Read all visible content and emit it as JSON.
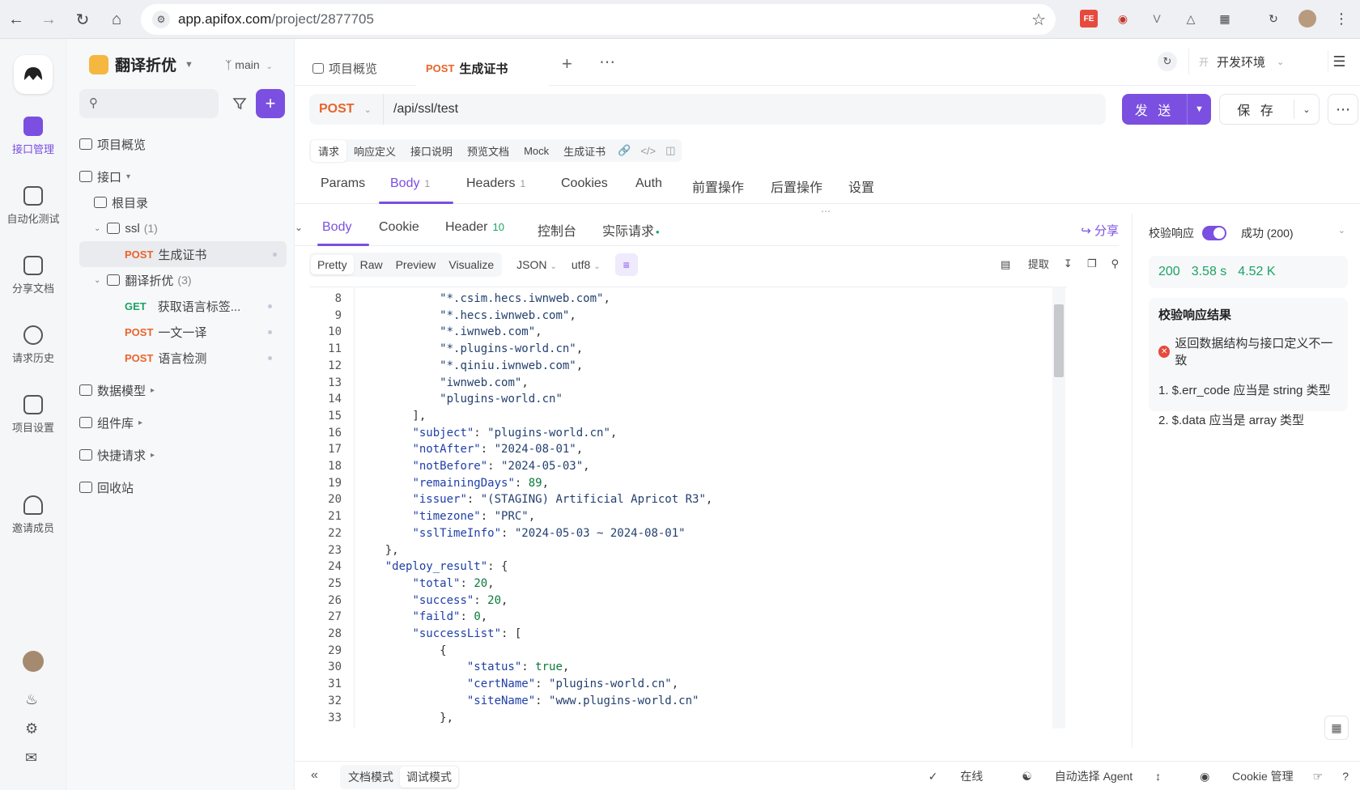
{
  "browser": {
    "url_host": "app.apifox.com",
    "url_path": "/project/2877705"
  },
  "rail": {
    "items": [
      {
        "label": "接口管理",
        "icon": "api-icon"
      },
      {
        "label": "自动化测试",
        "icon": "automation-icon"
      },
      {
        "label": "分享文档",
        "icon": "share-doc-icon"
      },
      {
        "label": "请求历史",
        "icon": "history-icon"
      },
      {
        "label": "项目设置",
        "icon": "settings-icon"
      },
      {
        "label": "邀请成员",
        "icon": "invite-icon"
      }
    ]
  },
  "sidebar": {
    "project_name": "翻译折优",
    "branch": "main",
    "tree": {
      "overview": "项目概览",
      "api": "接口",
      "root": "根目录",
      "ssl_folder": "ssl",
      "ssl_count": "(1)",
      "ssl_item_method": "POST",
      "ssl_item_name": "生成证书",
      "trans_folder": "翻译折优",
      "trans_count": "(3)",
      "trans_items": [
        {
          "method": "GET",
          "name": "获取语言标签..."
        },
        {
          "method": "POST",
          "name": "一文一译"
        },
        {
          "method": "POST",
          "name": "语言检测"
        }
      ],
      "data_model": "数据模型",
      "components": "组件库",
      "quick_request": "快捷请求",
      "recycle": "回收站"
    }
  },
  "tabs": {
    "overview": "项目概览",
    "active_method": "POST",
    "active_name": "生成证书",
    "env": "开发环境",
    "env_badge": "开"
  },
  "request": {
    "method": "POST",
    "path": "/api/ssl/test",
    "send": "发 送",
    "save": "保 存",
    "subtabs": [
      "请求",
      "响应定义",
      "接口说明",
      "预览文档",
      "Mock",
      "生成证书"
    ],
    "tabs": [
      {
        "label": "Params",
        "count": ""
      },
      {
        "label": "Body",
        "count": "1"
      },
      {
        "label": "Headers",
        "count": "1"
      },
      {
        "label": "Cookies",
        "count": ""
      },
      {
        "label": "Auth",
        "count": ""
      },
      {
        "label": "前置操作",
        "count": ""
      },
      {
        "label": "后置操作",
        "count": ""
      },
      {
        "label": "设置",
        "count": ""
      }
    ]
  },
  "response": {
    "tabs": [
      {
        "label": "Body",
        "count": ""
      },
      {
        "label": "Cookie",
        "count": ""
      },
      {
        "label": "Header",
        "count": "10"
      },
      {
        "label": "控制台",
        "count": ""
      },
      {
        "label": "实际请求",
        "count": "•"
      }
    ],
    "share": "分享",
    "formats": [
      "Pretty",
      "Raw",
      "Preview",
      "Visualize"
    ],
    "lang": "JSON",
    "encoding": "utf8",
    "extract": "提取",
    "lines": [
      {
        "n": "8",
        "t": "            \"*.csim.hecs.iwnweb.com\","
      },
      {
        "n": "9",
        "t": "            \"*.hecs.iwnweb.com\","
      },
      {
        "n": "10",
        "t": "            \"*.iwnweb.com\","
      },
      {
        "n": "11",
        "t": "            \"*.plugins-world.cn\","
      },
      {
        "n": "12",
        "t": "            \"*.qiniu.iwnweb.com\","
      },
      {
        "n": "13",
        "t": "            \"iwnweb.com\","
      },
      {
        "n": "14",
        "t": "            \"plugins-world.cn\""
      },
      {
        "n": "15",
        "t": "        ],"
      },
      {
        "n": "16",
        "t": "        \"subject\": \"plugins-world.cn\","
      },
      {
        "n": "17",
        "t": "        \"notAfter\": \"2024-08-01\","
      },
      {
        "n": "18",
        "t": "        \"notBefore\": \"2024-05-03\","
      },
      {
        "n": "19",
        "t": "        \"remainingDays\": 89,"
      },
      {
        "n": "20",
        "t": "        \"issuer\": \"(STAGING) Artificial Apricot R3\","
      },
      {
        "n": "21",
        "t": "        \"timezone\": \"PRC\","
      },
      {
        "n": "22",
        "t": "        \"sslTimeInfo\": \"2024-05-03 ~ 2024-08-01\""
      },
      {
        "n": "23",
        "t": "    },"
      },
      {
        "n": "24",
        "t": "    \"deploy_result\": {"
      },
      {
        "n": "25",
        "t": "        \"total\": 20,"
      },
      {
        "n": "26",
        "t": "        \"success\": 20,"
      },
      {
        "n": "27",
        "t": "        \"faild\": 0,"
      },
      {
        "n": "28",
        "t": "        \"successList\": ["
      },
      {
        "n": "29",
        "t": "            {"
      },
      {
        "n": "30",
        "t": "                \"status\": true,"
      },
      {
        "n": "31",
        "t": "                \"certName\": \"plugins-world.cn\","
      },
      {
        "n": "32",
        "t": "                \"siteName\": \"www.plugins-world.cn\""
      },
      {
        "n": "33",
        "t": "            },"
      }
    ]
  },
  "validation": {
    "label": "校验响应",
    "status": "成功 (200)",
    "code": "200",
    "time": "3.58 s",
    "size": "4.52 K",
    "result_title": "校验响应结果",
    "error": "返回数据结构与接口定义不一致",
    "items": [
      "1. $.err_code 应当是 string 类型",
      "2. $.data 应当是 array 类型"
    ]
  },
  "statusbar": {
    "doc_mode": "文档模式",
    "debug_mode": "调试模式",
    "online": "在线",
    "agent": "自动选择 Agent",
    "cookie": "Cookie 管理"
  },
  "colors": {
    "accent": "#7b4fe0",
    "post": "#e8642c",
    "get": "#1ba363"
  }
}
